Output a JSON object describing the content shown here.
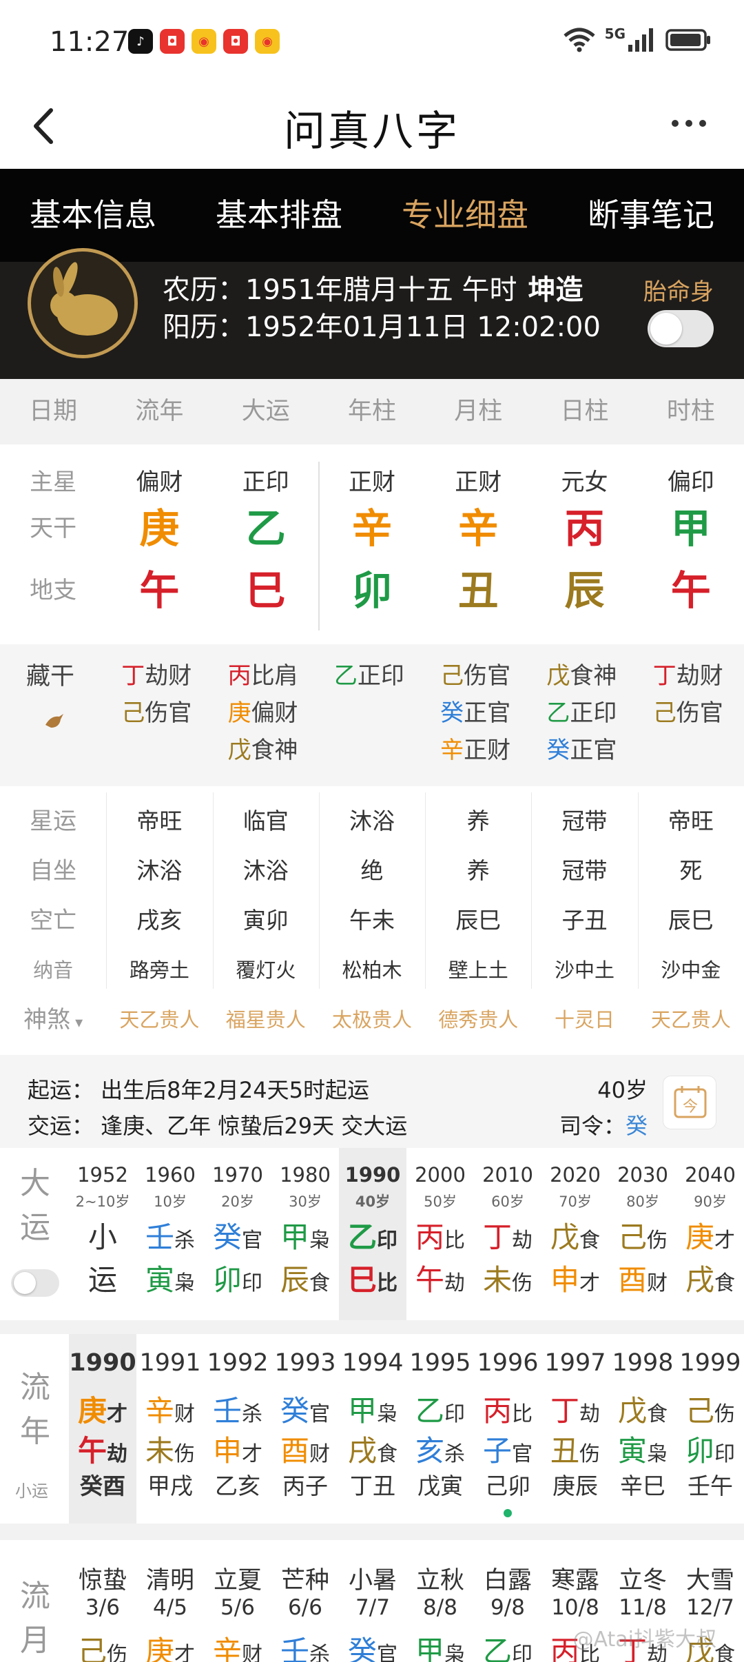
{
  "status_bar": {
    "time": "11:27",
    "network": "5G"
  },
  "nav": {
    "title": "问真八字"
  },
  "tabs": [
    "基本信息",
    "基本排盘",
    "专业细盘",
    "断事笔记"
  ],
  "colors": {
    "wood": "#1f9a46",
    "fire": "#d6202a",
    "earth": "#9c7a1f",
    "metal": "#f08c00",
    "water": "#2f7fd8",
    "accent": "#d9a460"
  },
  "profile": {
    "lunar_label": "农历：",
    "lunar": "1951年腊月十五 午时",
    "gender": "坤造",
    "solar_label": "阳历：",
    "solar": "1952年01月11日 12:02:00",
    "taimingshen": "胎命身"
  },
  "header": [
    "日期",
    "流年",
    "大运",
    "年柱",
    "月柱",
    "日柱",
    "时柱"
  ],
  "main": {
    "labels": [
      "主星",
      "天干",
      "地支"
    ],
    "columns": [
      {
        "star": "偏财",
        "gan": "庚",
        "gan_color": "#f08c00",
        "zhi": "午",
        "zhi_color": "#d6202a"
      },
      {
        "star": "正印",
        "gan": "乙",
        "gan_color": "#1f9a46",
        "zhi": "巳",
        "zhi_color": "#d6202a"
      },
      {
        "star": "正财",
        "gan": "辛",
        "gan_color": "#f08c00",
        "zhi": "卯",
        "zhi_color": "#1f9a46"
      },
      {
        "star": "正财",
        "gan": "辛",
        "gan_color": "#f08c00",
        "zhi": "丑",
        "zhi_color": "#9c7a1f"
      },
      {
        "star": "元女",
        "gan": "丙",
        "gan_color": "#d6202a",
        "zhi": "辰",
        "zhi_color": "#9c7a1f"
      },
      {
        "star": "偏印",
        "gan": "甲",
        "gan_color": "#1f9a46",
        "zhi": "午",
        "zhi_color": "#d6202a"
      }
    ]
  },
  "canggan": {
    "label": "藏干",
    "columns": [
      [
        {
          "g": "丁",
          "c": "#d6202a",
          "t": "劫财"
        },
        {
          "g": "己",
          "c": "#9c7a1f",
          "t": "伤官"
        }
      ],
      [
        {
          "g": "丙",
          "c": "#d6202a",
          "t": "比肩"
        },
        {
          "g": "庚",
          "c": "#f08c00",
          "t": "偏财"
        },
        {
          "g": "戊",
          "c": "#9c7a1f",
          "t": "食神"
        }
      ],
      [
        {
          "g": "乙",
          "c": "#1f9a46",
          "t": "正印"
        }
      ],
      [
        {
          "g": "己",
          "c": "#9c7a1f",
          "t": "伤官"
        },
        {
          "g": "癸",
          "c": "#2f7fd8",
          "t": "正官"
        },
        {
          "g": "辛",
          "c": "#f08c00",
          "t": "正财"
        }
      ],
      [
        {
          "g": "戊",
          "c": "#9c7a1f",
          "t": "食神"
        },
        {
          "g": "乙",
          "c": "#1f9a46",
          "t": "正印"
        },
        {
          "g": "癸",
          "c": "#2f7fd8",
          "t": "正官"
        }
      ],
      [
        {
          "g": "丁",
          "c": "#d6202a",
          "t": "劫财"
        },
        {
          "g": "己",
          "c": "#9c7a1f",
          "t": "伤官"
        }
      ]
    ]
  },
  "yun_rows": [
    {
      "label": "星运",
      "values": [
        "帝旺",
        "临官",
        "沐浴",
        "养",
        "冠带",
        "帝旺"
      ]
    },
    {
      "label": "自坐",
      "values": [
        "沐浴",
        "沐浴",
        "绝",
        "养",
        "冠带",
        "死"
      ]
    },
    {
      "label": "空亡",
      "values": [
        "戌亥",
        "寅卯",
        "午未",
        "辰巳",
        "子丑",
        "辰巳"
      ]
    },
    {
      "label": "纳音",
      "values": [
        "路旁土",
        "覆灯火",
        "松柏木",
        "壁上土",
        "沙中土",
        "沙中金"
      ]
    }
  ],
  "shensha": {
    "label": "神煞",
    "values": [
      "天乙贵人",
      "福星贵人",
      "太极贵人",
      "德秀贵人",
      "十灵日",
      "天乙贵人"
    ]
  },
  "qiyun": {
    "line1": "起运：  出生后8年2月24天5时起运",
    "line2": "交运：  逢庚、乙年 惊蛰后29天 交大运",
    "age": "40岁",
    "siling_label": "司令：",
    "siling": "癸"
  },
  "dayun": {
    "label": "大运",
    "columns": [
      {
        "year": "1952",
        "age": "2~10岁",
        "g1": "小",
        "g1c": "#333",
        "s1": "",
        "g2": "运",
        "g2c": "#333",
        "s2": ""
      },
      {
        "year": "1960",
        "age": "10岁",
        "g1": "壬",
        "g1c": "#2f7fd8",
        "s1": "杀",
        "g2": "寅",
        "g2c": "#1f9a46",
        "s2": "枭"
      },
      {
        "year": "1970",
        "age": "20岁",
        "g1": "癸",
        "g1c": "#2f7fd8",
        "s1": "官",
        "g2": "卯",
        "g2c": "#1f9a46",
        "s2": "印"
      },
      {
        "year": "1980",
        "age": "30岁",
        "g1": "甲",
        "g1c": "#1f9a46",
        "s1": "枭",
        "g2": "辰",
        "g2c": "#9c7a1f",
        "s2": "食"
      },
      {
        "year": "1990",
        "age": "40岁",
        "g1": "乙",
        "g1c": "#1f9a46",
        "s1": "印",
        "g2": "巳",
        "g2c": "#d6202a",
        "s2": "比"
      },
      {
        "year": "2000",
        "age": "50岁",
        "g1": "丙",
        "g1c": "#d6202a",
        "s1": "比",
        "g2": "午",
        "g2c": "#d6202a",
        "s2": "劫"
      },
      {
        "year": "2010",
        "age": "60岁",
        "g1": "丁",
        "g1c": "#d6202a",
        "s1": "劫",
        "g2": "未",
        "g2c": "#9c7a1f",
        "s2": "伤"
      },
      {
        "year": "2020",
        "age": "70岁",
        "g1": "戊",
        "g1c": "#9c7a1f",
        "s1": "食",
        "g2": "申",
        "g2c": "#f08c00",
        "s2": "才"
      },
      {
        "year": "2030",
        "age": "80岁",
        "g1": "己",
        "g1c": "#9c7a1f",
        "s1": "伤",
        "g2": "酉",
        "g2c": "#f08c00",
        "s2": "财"
      },
      {
        "year": "2040",
        "age": "90岁",
        "g1": "庚",
        "g1c": "#f08c00",
        "s1": "才",
        "g2": "戌",
        "g2c": "#9c7a1f",
        "s2": "食"
      }
    ]
  },
  "liunian": {
    "label": "流年",
    "sub_label": "小运",
    "columns": [
      {
        "year": "1990",
        "g1": "庚",
        "g1c": "#f08c00",
        "s1": "才",
        "g2": "午",
        "g2c": "#d6202a",
        "s2": "劫",
        "xs": "癸酉"
      },
      {
        "year": "1991",
        "g1": "辛",
        "g1c": "#f08c00",
        "s1": "财",
        "g2": "未",
        "g2c": "#9c7a1f",
        "s2": "伤",
        "xs": "甲戌"
      },
      {
        "year": "1992",
        "g1": "壬",
        "g1c": "#2f7fd8",
        "s1": "杀",
        "g2": "申",
        "g2c": "#f08c00",
        "s2": "才",
        "xs": "乙亥"
      },
      {
        "year": "1993",
        "g1": "癸",
        "g1c": "#2f7fd8",
        "s1": "官",
        "g2": "酉",
        "g2c": "#f08c00",
        "s2": "财",
        "xs": "丙子"
      },
      {
        "year": "1994",
        "g1": "甲",
        "g1c": "#1f9a46",
        "s1": "枭",
        "g2": "戌",
        "g2c": "#9c7a1f",
        "s2": "食",
        "xs": "丁丑"
      },
      {
        "year": "1995",
        "g1": "乙",
        "g1c": "#1f9a46",
        "s1": "印",
        "g2": "亥",
        "g2c": "#2f7fd8",
        "s2": "杀",
        "xs": "戊寅"
      },
      {
        "year": "1996",
        "g1": "丙",
        "g1c": "#d6202a",
        "s1": "比",
        "g2": "子",
        "g2c": "#2f7fd8",
        "s2": "官",
        "xs": "己卯"
      },
      {
        "year": "1997",
        "g1": "丁",
        "g1c": "#d6202a",
        "s1": "劫",
        "g2": "丑",
        "g2c": "#9c7a1f",
        "s2": "伤",
        "xs": "庚辰"
      },
      {
        "year": "1998",
        "g1": "戊",
        "g1c": "#9c7a1f",
        "s1": "食",
        "g2": "寅",
        "g2c": "#1f9a46",
        "s2": "枭",
        "xs": "辛巳"
      },
      {
        "year": "1999",
        "g1": "己",
        "g1c": "#9c7a1f",
        "s1": "伤",
        "g2": "卯",
        "g2c": "#1f9a46",
        "s2": "印",
        "xs": "壬午"
      }
    ]
  },
  "liuyue": {
    "label": "流月",
    "columns": [
      {
        "jq": "惊蛰",
        "date": "3/6",
        "g1": "己",
        "g1c": "#9c7a1f",
        "s1": "伤"
      },
      {
        "jq": "清明",
        "date": "4/5",
        "g1": "庚",
        "g1c": "#f08c00",
        "s1": "才"
      },
      {
        "jq": "立夏",
        "date": "5/6",
        "g1": "辛",
        "g1c": "#f08c00",
        "s1": "财"
      },
      {
        "jq": "芒种",
        "date": "6/6",
        "g1": "壬",
        "g1c": "#2f7fd8",
        "s1": "杀"
      },
      {
        "jq": "小暑",
        "date": "7/7",
        "g1": "癸",
        "g1c": "#2f7fd8",
        "s1": "官"
      },
      {
        "jq": "立秋",
        "date": "8/8",
        "g1": "甲",
        "g1c": "#1f9a46",
        "s1": "枭"
      },
      {
        "jq": "白露",
        "date": "9/8",
        "g1": "乙",
        "g1c": "#1f9a46",
        "s1": "印"
      },
      {
        "jq": "寒露",
        "date": "10/8",
        "g1": "丙",
        "g1c": "#d6202a",
        "s1": "比"
      },
      {
        "jq": "立冬",
        "date": "11/8",
        "g1": "丁",
        "g1c": "#d6202a",
        "s1": "劫"
      },
      {
        "jq": "大雪",
        "date": "12/7",
        "g1": "戊",
        "g1c": "#9c7a1f",
        "s1": "食"
      }
    ]
  },
  "watermark": "@Atai抖紫大叔"
}
